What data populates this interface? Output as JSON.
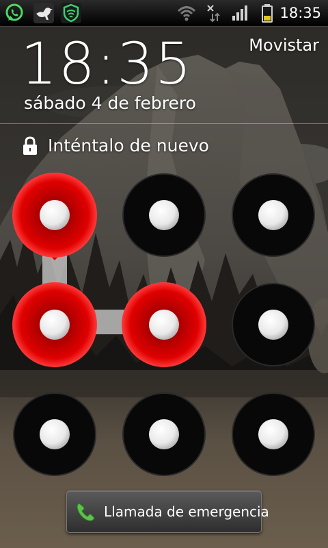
{
  "status_bar": {
    "time": "18:35",
    "icons": [
      "whatsapp-icon",
      "bird-app-icon",
      "security-app-icon",
      "wifi-icon",
      "data-off-icon",
      "signal-icon",
      "battery-icon"
    ]
  },
  "lockscreen": {
    "time": "18:35",
    "date": "sábado 4 de febrero",
    "carrier": "Movistar",
    "status_message": "Inténtalo de nuevo",
    "emergency_button_label": "Llamada de emergencia"
  },
  "pattern": {
    "grid": "3x3",
    "selected": [
      1,
      4,
      5
    ],
    "error_state": true
  },
  "colors": {
    "error_red": "#d10000",
    "dot_white": "#f2f2f2",
    "ring_black": "#080808",
    "accent_green": "#3bd16f"
  }
}
